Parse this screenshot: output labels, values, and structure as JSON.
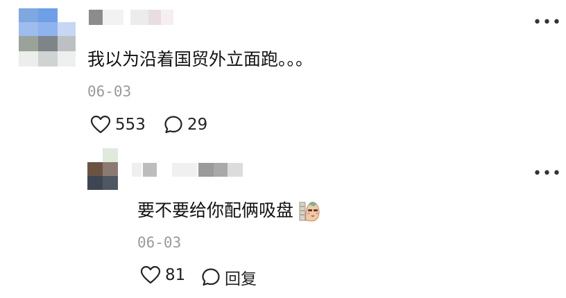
{
  "comment": {
    "text": "我以为沿着国贸外立面跑。。。",
    "date": "06-03",
    "likes": "553",
    "replies": "29",
    "icons": {
      "more": "more-dots-icon",
      "like": "heart-icon",
      "reply": "speech-bubble-icon"
    }
  },
  "reply": {
    "text": "要不要给你配俩吸盘",
    "date": "06-03",
    "likes": "81",
    "reply_label": "回复",
    "icons": {
      "more": "more-dots-icon",
      "like": "heart-icon",
      "reply": "speech-bubble-icon",
      "sticker": "sticker-emoji"
    }
  },
  "colors": {
    "text": "#111111",
    "meta": "#9a9a9a"
  }
}
